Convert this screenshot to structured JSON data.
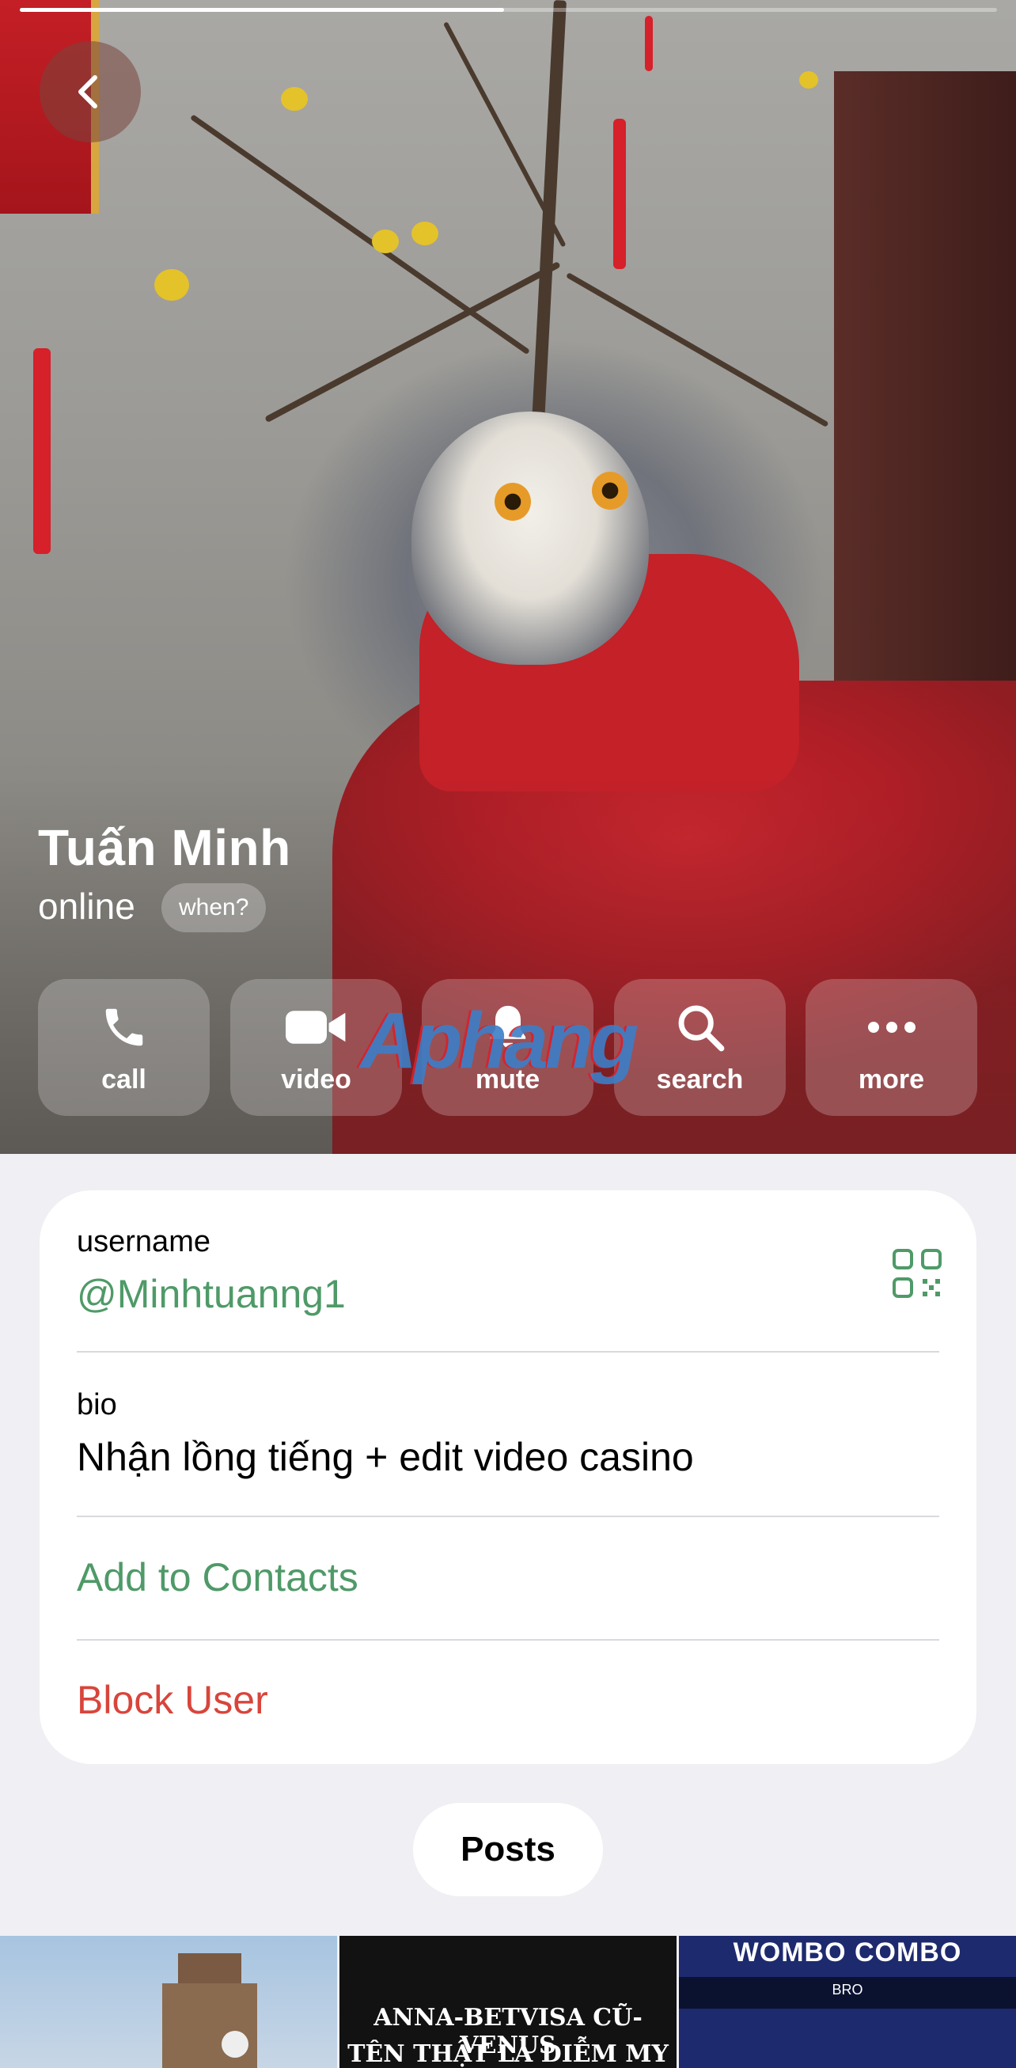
{
  "profile": {
    "name": "Tuấn Minh",
    "status": "online",
    "when_label": "when?"
  },
  "actions": [
    {
      "label": "call",
      "icon": "phone-icon"
    },
    {
      "label": "video",
      "icon": "video-camera-icon"
    },
    {
      "label": "mute",
      "icon": "bell-icon"
    },
    {
      "label": "search",
      "icon": "search-icon"
    },
    {
      "label": "more",
      "icon": "more-dots-icon"
    }
  ],
  "watermark": "Aphang",
  "info": {
    "username_label": "username",
    "username_value": "@Minhtuanng1",
    "bio_label": "bio",
    "bio_value": "Nhận lồng tiếng + edit video casino",
    "add_contacts": "Add to Contacts",
    "block_user": "Block User"
  },
  "tabs": {
    "posts": "Posts"
  },
  "thumbnails": {
    "second_line1": "ANNA-BETVISA CŨ- VENUS",
    "second_line2": "TÊN THẬT LÀ DIỄM MY",
    "third_title": "WOMBO COMBO",
    "third_ticker": "BRO"
  },
  "colors": {
    "accent_green": "#4f9a68",
    "destructive_red": "#d8453b",
    "background": "#efeff4"
  }
}
